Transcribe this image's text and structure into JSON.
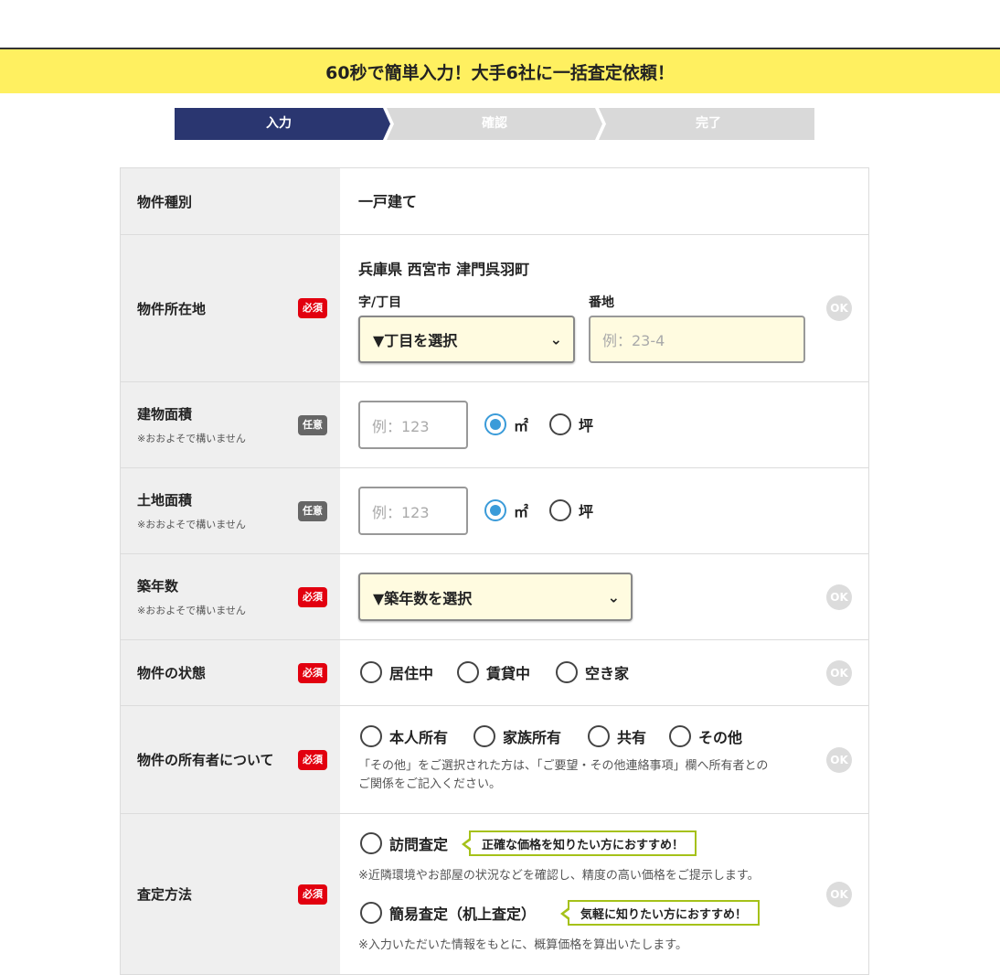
{
  "banner": {
    "text": "60秒で簡単入力！大手6社に一括査定依頼！"
  },
  "steps": [
    {
      "label": "入力",
      "active": true
    },
    {
      "label": "確認",
      "active": false
    },
    {
      "label": "完了",
      "active": false
    }
  ],
  "colors": {
    "banner": "#fff060",
    "step_active": "#2a3670",
    "step_inactive": "#d9d9d9",
    "required": "#e2000f",
    "optional": "#666666",
    "radio_selected": "#3a9bd9",
    "tip_border": "#a5c119"
  },
  "ok_label": "OK",
  "badges": {
    "required": "必須",
    "optional": "任意"
  },
  "rows": {
    "type": {
      "label": "物件種別",
      "value": "一戸建て"
    },
    "location": {
      "label": "物件所在地",
      "address": "兵庫県 西宮市 津門呉羽町",
      "chome_label": "字/丁目",
      "chome_select": "▼丁目を選択",
      "banchi_label": "番地",
      "banchi_placeholder": "例：23-4"
    },
    "building_area": {
      "label": "建物面積",
      "sub": "※おおよそで構いません",
      "placeholder": "例：123",
      "unit_m2": "㎡",
      "unit_tsubo": "坪"
    },
    "land_area": {
      "label": "土地面積",
      "sub": "※おおよそで構いません",
      "placeholder": "例：123",
      "unit_m2": "㎡",
      "unit_tsubo": "坪"
    },
    "age": {
      "label": "築年数",
      "sub": "※おおよそで構いません",
      "select": "▼築年数を選択"
    },
    "status": {
      "label": "物件の状態",
      "options": [
        "居住中",
        "賃貸中",
        "空き家"
      ]
    },
    "owner": {
      "label": "物件の所有者について",
      "options": [
        "本人所有",
        "家族所有",
        "共有",
        "その他"
      ],
      "note_line1": "「その他」をご選択された方は、「ご要望・その他連絡事項」欄へ所有者との",
      "note_line2": "ご関係をご記入ください。"
    },
    "method": {
      "label": "査定方法",
      "visit_label": "訪問査定",
      "visit_tip": "正確な価格を知りたい方におすすめ！",
      "visit_note": "※近隣環境やお部屋の状況などを確認し、精度の高い価格をご提示します。",
      "simple_label": "簡易査定（机上査定）",
      "simple_tip": "気軽に知りたい方におすすめ！",
      "simple_note": "※入力いただいた情報をもとに、概算価格を算出いたします。"
    }
  }
}
